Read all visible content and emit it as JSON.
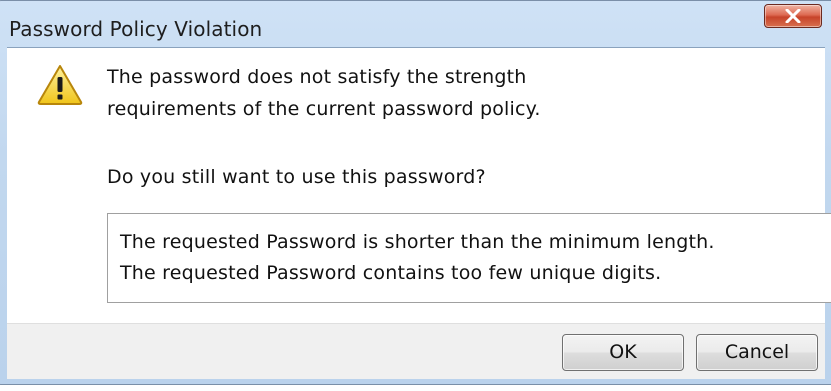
{
  "dialog": {
    "title": "Password Policy Violation",
    "message_line_1": "The password does not satisfy the strength",
    "message_line_2": "requirements of the current password policy.",
    "question": "Do you still want to use this password?",
    "details": [
      "The requested Password is shorter than the minimum length.",
      "The requested Password contains too few unique digits."
    ],
    "icon": "warning-icon"
  },
  "buttons": {
    "ok_label": "OK",
    "cancel_label": "Cancel",
    "close_icon": "close-icon"
  },
  "colors": {
    "close_button": "#c7432a",
    "warning_fill": "#f2d44a",
    "frame": "#c2d8ef"
  }
}
